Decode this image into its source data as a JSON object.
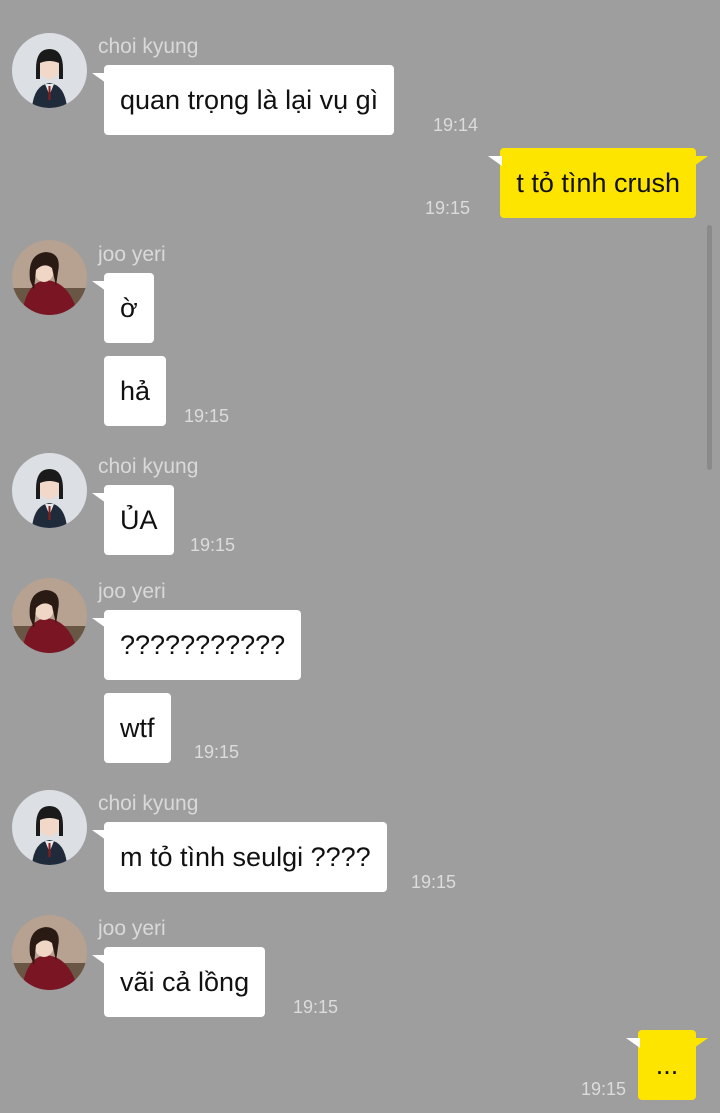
{
  "messages": [
    {
      "sender": "choi kyung",
      "text": "quan trọng là lại vụ gì",
      "time": "19:14"
    },
    {
      "sender": "me",
      "text": "t tỏ tình crush",
      "time": "19:15"
    },
    {
      "sender": "joo yeri",
      "text": "ờ"
    },
    {
      "sender": "joo yeri",
      "text": "hả",
      "time": "19:15"
    },
    {
      "sender": "choi kyung",
      "text": "ỦA",
      "time": "19:15"
    },
    {
      "sender": "joo yeri",
      "text": "???????????"
    },
    {
      "sender": "joo yeri",
      "text": "wtf",
      "time": "19:15"
    },
    {
      "sender": "choi kyung",
      "text": "m tỏ tình seulgi ????",
      "time": "19:15"
    },
    {
      "sender": "joo yeri",
      "text": "vãi cả lồng",
      "time": "19:15"
    },
    {
      "sender": "me",
      "text": "...",
      "time": "19:15"
    }
  ],
  "avatars": {
    "choi_kyung": "choi-kyung-avatar",
    "joo_yeri": "joo-yeri-avatar"
  },
  "colors": {
    "background": "#9e9e9e",
    "incoming_bubble": "#ffffff",
    "outgoing_bubble": "#fee500"
  }
}
